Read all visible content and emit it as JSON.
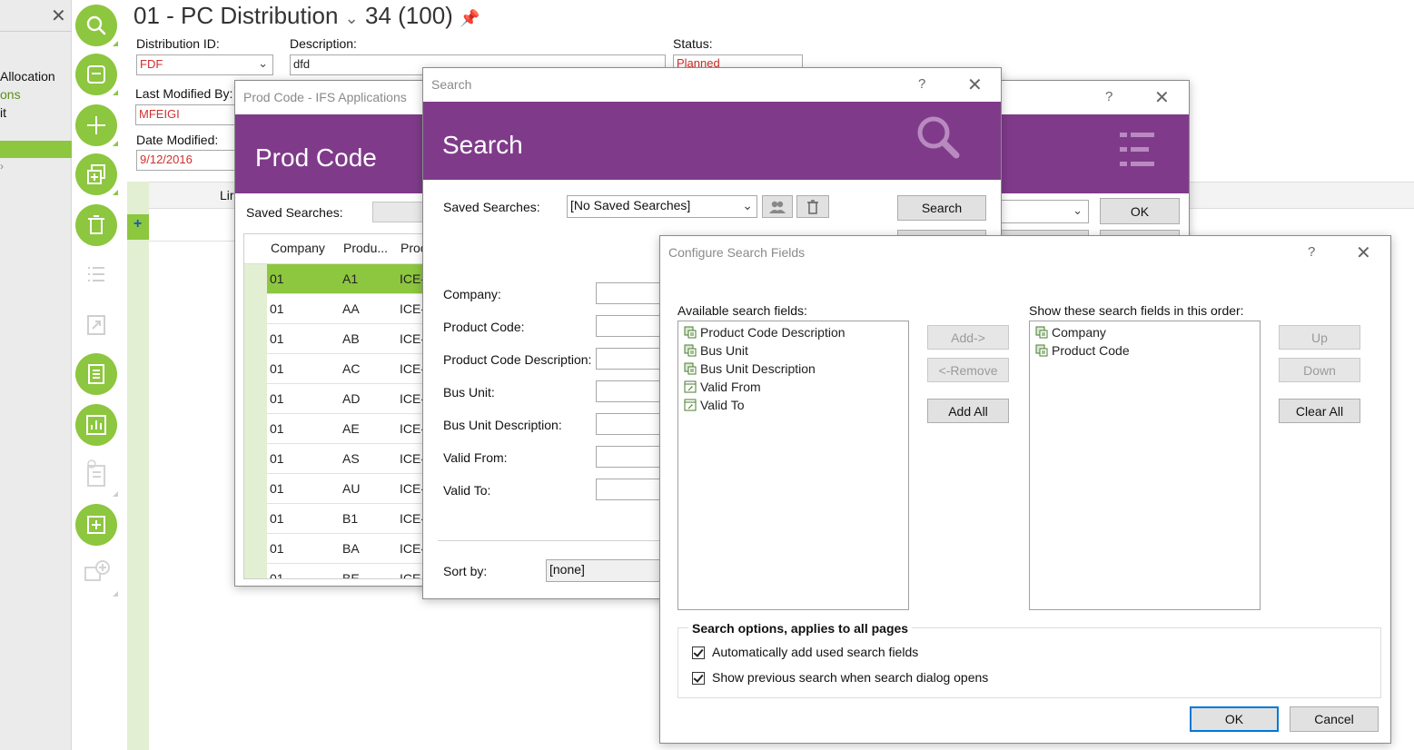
{
  "leftnav": {
    "close": "✕",
    "items": [
      "Allocation",
      "ons",
      "it"
    ]
  },
  "toolbar": {
    "icons": [
      "search-icon",
      "save-icon",
      "add-icon",
      "duplicate-icon",
      "delete-icon",
      "list-icon",
      "export-icon",
      "details-icon",
      "chart-icon",
      "info-icon",
      "new-note-icon",
      "add-comment-icon"
    ]
  },
  "page": {
    "title": "01 - PC Distribution",
    "record": "34 (100)",
    "distribution_id_label": "Distribution ID:",
    "distribution_id": "FDF",
    "description_label": "Description:",
    "description": "dfd",
    "status_label": "Status:",
    "status": "Planned",
    "last_modified_by_label": "Last Modified By:",
    "last_modified_by": "MFEIGI",
    "date_modified_label": "Date Modified:",
    "date_modified": "9/12/2016",
    "lines_label": "Lir"
  },
  "prodcode_dialog": {
    "title": "Prod Code  - IFS Applications",
    "header": "Prod Code",
    "saved_searches_label": "Saved Searches:",
    "columns": [
      "Company",
      "Produ...",
      "Proc"
    ],
    "rows": [
      {
        "company": "01",
        "product": "A1",
        "desc": "ICE-"
      },
      {
        "company": "01",
        "product": "AA",
        "desc": "ICE-"
      },
      {
        "company": "01",
        "product": "AB",
        "desc": "ICE-"
      },
      {
        "company": "01",
        "product": "AC",
        "desc": "ICE-"
      },
      {
        "company": "01",
        "product": "AD",
        "desc": "ICE-"
      },
      {
        "company": "01",
        "product": "AE",
        "desc": "ICE-"
      },
      {
        "company": "01",
        "product": "AS",
        "desc": "ICE-"
      },
      {
        "company": "01",
        "product": "AU",
        "desc": "ICE-"
      },
      {
        "company": "01",
        "product": "B1",
        "desc": "ICE-"
      },
      {
        "company": "01",
        "product": "BA",
        "desc": "ICE-"
      },
      {
        "company": "01",
        "product": "BE",
        "desc": "ICE-"
      }
    ],
    "help": "?",
    "close": "✕",
    "ok_label": "OK"
  },
  "search_dialog": {
    "title": "Search",
    "header": "Search",
    "help": "?",
    "close": "✕",
    "saved_searches_label": "Saved Searches:",
    "saved_searches_value": "[No Saved Searches]",
    "search_button": "Search",
    "fields": [
      "Company:",
      "Product Code:",
      "Product Code Description:",
      "Bus Unit:",
      "Bus Unit Description:",
      "Valid From:",
      "Valid To:"
    ],
    "sort_by_label": "Sort by:",
    "sort_by_value": "[none]"
  },
  "configure_dialog": {
    "title": "Configure Search Fields",
    "help": "?",
    "close": "✕",
    "available_label": "Available search fields:",
    "available": [
      "Product Code Description",
      "Bus Unit",
      "Bus Unit Description",
      "Valid From",
      "Valid To"
    ],
    "shown_label": "Show these search fields in this order:",
    "shown": [
      "Company",
      "Product Code"
    ],
    "add_button": "Add->",
    "remove_button": "<-Remove",
    "add_all_button": "Add All",
    "up_button": "Up",
    "down_button": "Down",
    "clear_all_button": "Clear All",
    "options_label": "Search options, applies to all pages",
    "option_auto_add": "Automatically add used search fields",
    "option_show_previous": "Show previous search when search dialog opens",
    "ok_button": "OK",
    "cancel_button": "Cancel"
  },
  "colors": {
    "accent_green": "#8dc63f",
    "purple": "#7f3b8a",
    "error_red": "#d0302c"
  }
}
